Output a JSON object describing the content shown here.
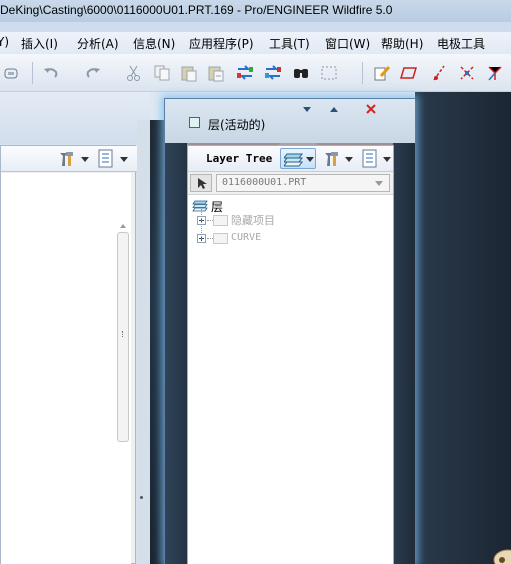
{
  "window": {
    "title": "DeKing\\Casting\\6000\\0116000U01.PRT.169 - Pro/ENGINEER Wildfire 5.0"
  },
  "menu": {
    "items": [
      {
        "label": "Y)"
      },
      {
        "label": "插入(I)"
      },
      {
        "label": "分析(A)"
      },
      {
        "label": "信息(N)"
      },
      {
        "label": "应用程序(P)"
      },
      {
        "label": "工具(T)"
      },
      {
        "label": "窗口(W)"
      },
      {
        "label": "帮助(H)"
      },
      {
        "label": "电极工具"
      }
    ]
  },
  "toolbar": {
    "icons": [
      "regenerate-icon",
      "undo-icon",
      "redo-icon",
      "cut-icon",
      "copy-icon",
      "paste-icon",
      "paste-special-icon",
      "copy-geometry-icon",
      "merge-icon",
      "find-icon",
      "select-box-icon",
      "sketch-icon",
      "plane-icon",
      "axis-icon",
      "point-icon",
      "csys-icon"
    ]
  },
  "dialog": {
    "title": "层(活动的)",
    "layer_tree_label": "Layer Tree",
    "model_name": "0116000U01.PRT",
    "tree": {
      "root_label": "层",
      "items": [
        {
          "label": "隐藏项目"
        },
        {
          "label": "CURVE"
        }
      ]
    }
  },
  "colors": {
    "accent": "#4f86c6",
    "close": "#d62424",
    "disabled_text": "#a9a9a9"
  }
}
